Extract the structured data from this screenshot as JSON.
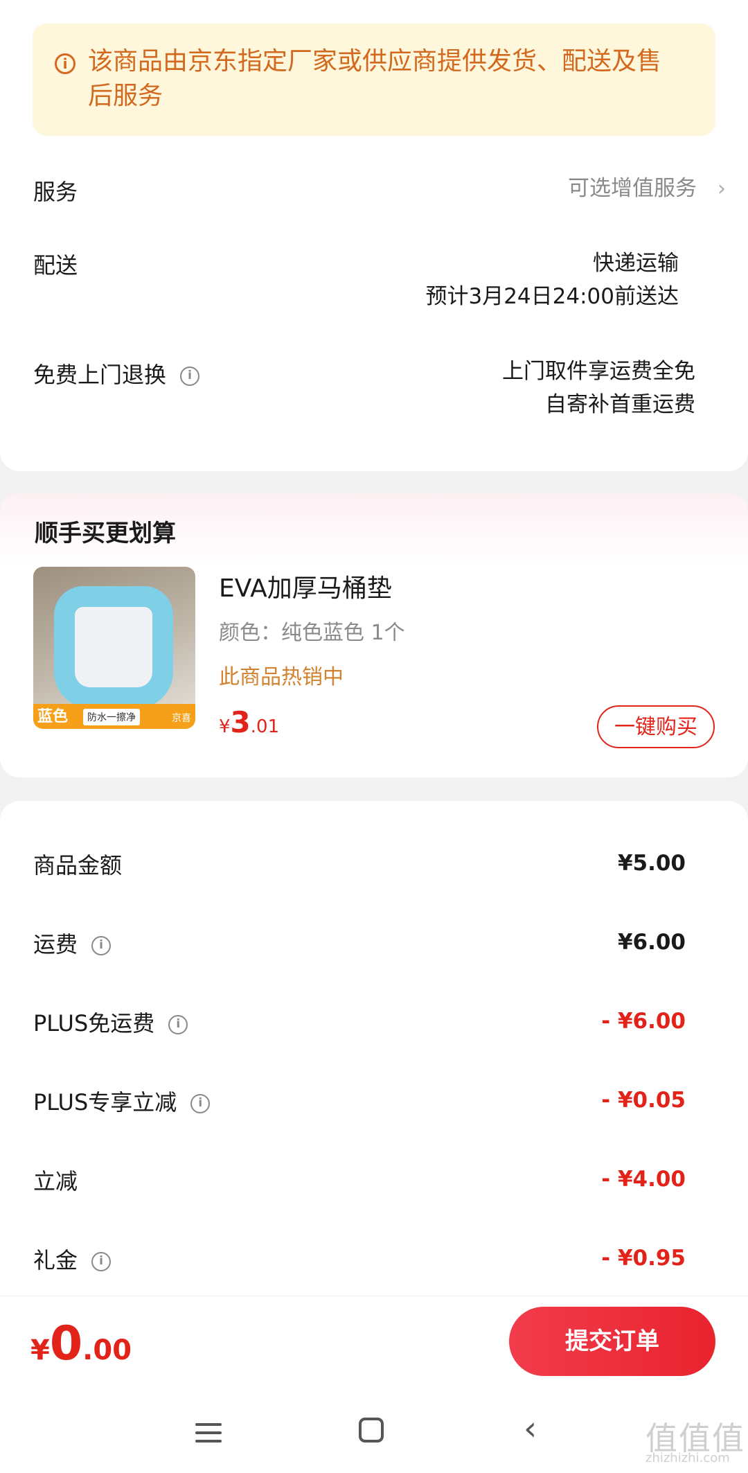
{
  "notice": {
    "text": "该商品由京东指定厂家或供应商提供发货、配送及售后服务",
    "icon": "info-circle-icon"
  },
  "service": {
    "label": "服务",
    "value": "可选增值服务",
    "chevron": "›"
  },
  "delivery": {
    "label": "配送",
    "method": "快递运输",
    "eta": "预计3月24日24:00前送达"
  },
  "returns": {
    "label": "免费上门退换",
    "line1": "上门取件享运费全免",
    "line2": "自寄补首重运费"
  },
  "addon": {
    "title": "顺手买更划算",
    "product": {
      "name": "EVA加厚马桶垫",
      "spec": "颜色：纯色蓝色 1个",
      "hot": "此商品热销中",
      "price_symbol": "¥",
      "price_int": "3",
      "price_dec": ".01",
      "thumb_tag": "蓝色",
      "thumb_mid": "防水一擦净",
      "thumb_right": "京喜",
      "buy_label": "一键购买"
    }
  },
  "summary": {
    "rows": [
      {
        "label": "商品金额",
        "value": "¥5.00",
        "info": false,
        "red": false
      },
      {
        "label": "运费",
        "value": "¥6.00",
        "info": true,
        "red": false
      },
      {
        "label": "PLUS免运费",
        "value": "- ¥6.00",
        "info": true,
        "red": true
      },
      {
        "label": "PLUS专享立减",
        "value": "- ¥0.05",
        "info": true,
        "red": true
      },
      {
        "label": "立减",
        "value": "- ¥4.00",
        "info": false,
        "red": true
      },
      {
        "label": "礼金",
        "value": "- ¥0.95",
        "info": true,
        "red": true
      }
    ]
  },
  "footer": {
    "symbol": "¥",
    "int": "0",
    "dec": ".00",
    "submit_label": "提交订单"
  },
  "watermark": {
    "main": "值值值",
    "sub": "zhizhizhi.com"
  },
  "colors": {
    "accent": "#e2231a",
    "notice_text": "#d2691e",
    "notice_bg": "#fef7dc",
    "hot": "#d2822e"
  }
}
